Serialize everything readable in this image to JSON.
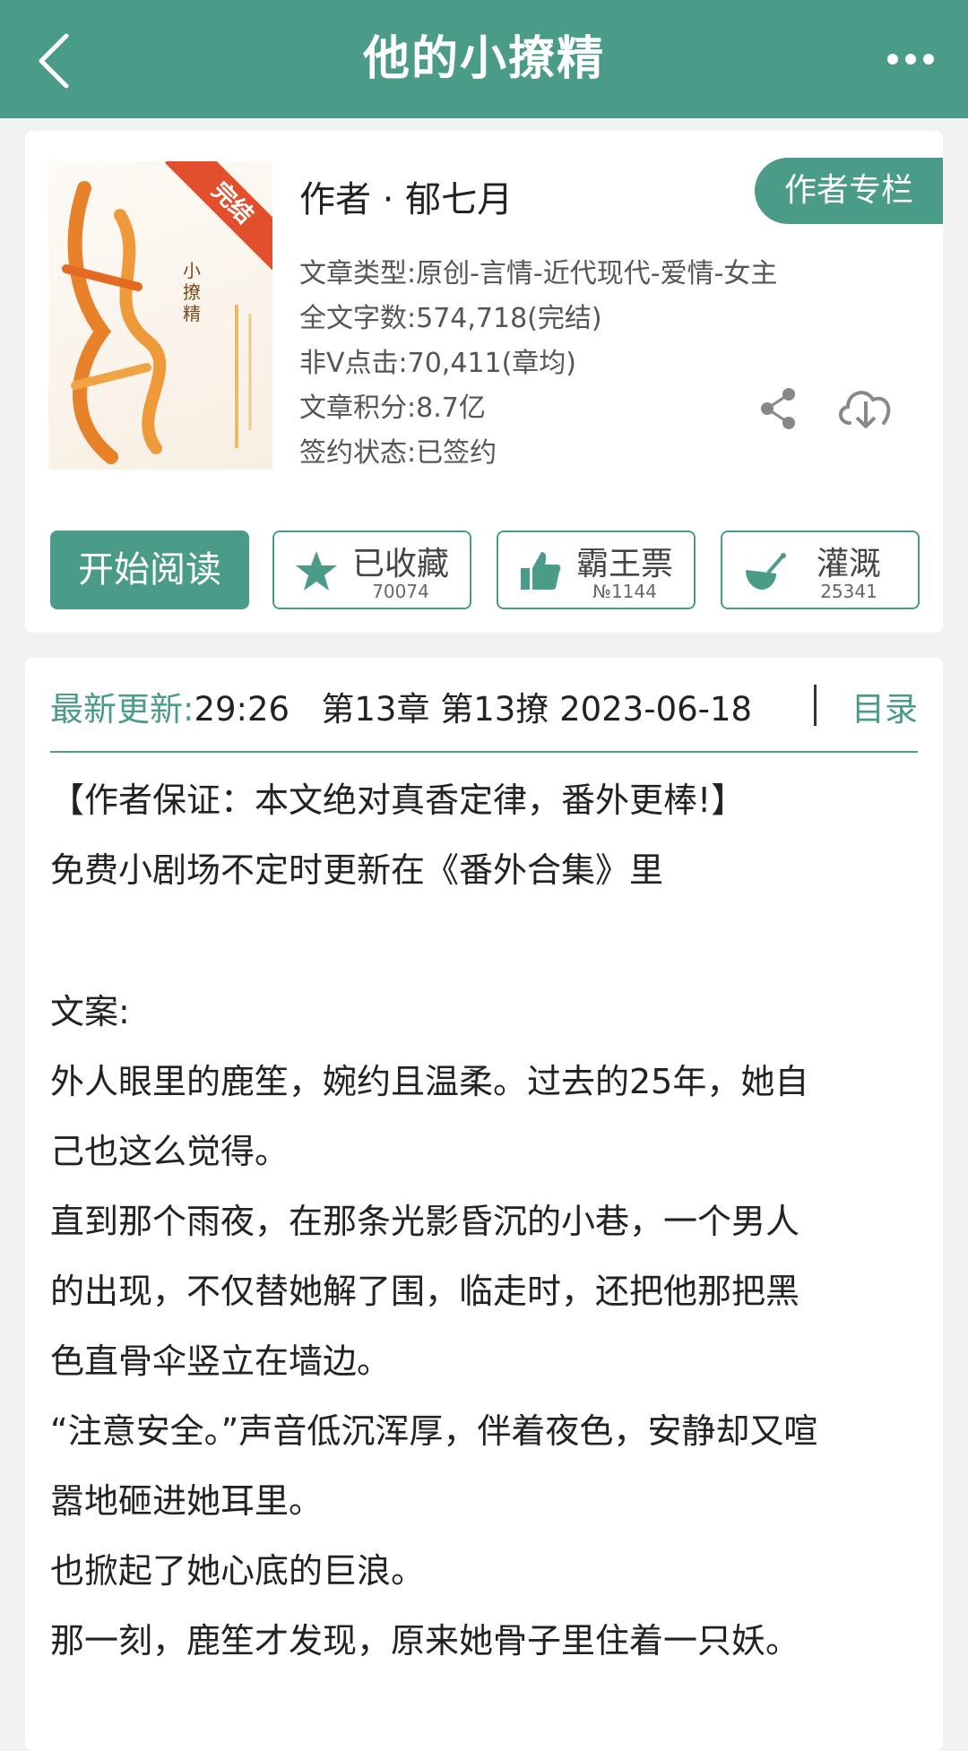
{
  "header": {
    "title": "他的小撩精",
    "back_icon": "chevron-left-icon",
    "more_icon": "ellipsis-icon"
  },
  "book": {
    "cover": {
      "ribbon": "完结",
      "title_art": "小撩精"
    },
    "author_line": "作者 · 郁七月",
    "author_column": "作者专栏",
    "meta": [
      "文章类型:原创-言情-近代现代-爱情-女主",
      "全文字数:574,718(完结)",
      "非V点击:70,411(章均)",
      "文章积分:8.7亿",
      "签约状态:已签约"
    ],
    "share_icon": "share-icon",
    "download_icon": "cloud-download-icon"
  },
  "actions": {
    "read": "开始阅读",
    "favorite": {
      "label": "已收藏",
      "count": "70074",
      "icon": "star-icon"
    },
    "vote": {
      "label": "霸王票",
      "count": "№1144",
      "icon": "thumbs-up-icon"
    },
    "water": {
      "label": "灌溉",
      "count": "25341",
      "icon": "watering-icon"
    }
  },
  "update": {
    "label": "最新更新:",
    "value": "29:26   第13章 第13撩 2023-06-18",
    "toc": "目录"
  },
  "intro": [
    "【作者保证：本文绝对真香定律，番外更棒!】",
    "免费小剧场不定时更新在《番外合集》里",
    "文案:",
    "外人眼里的鹿笙，婉约且温柔。过去的25年，她自",
    "己也这么觉得。",
    "直到那个雨夜，在那条光影昏沉的小巷，一个男人",
    "的出现，不仅替她解了围，临走时，还把他那把黑",
    "色直骨伞竖立在墙边。",
    "“注意安全。”声音低沉浑厚，伴着夜色，安静却又喧",
    "嚣地砸进她耳里。",
    "也掀起了她心底的巨浪。",
    "那一刻，鹿笙才发现，原来她骨子里住着一只妖。"
  ],
  "colors": {
    "accent": "#4a9c88",
    "ribbon": "#e24f2c"
  }
}
